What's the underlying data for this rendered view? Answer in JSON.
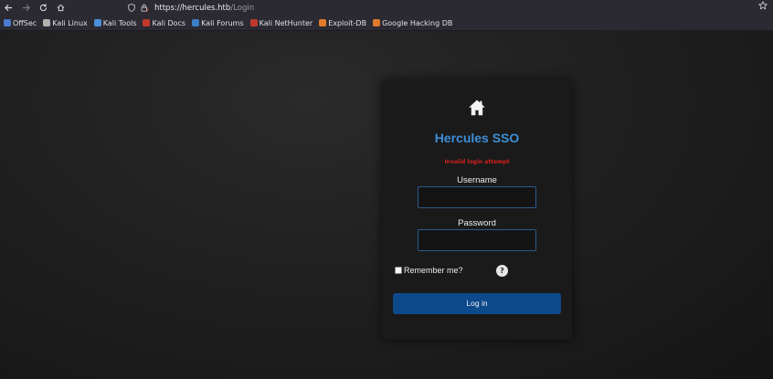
{
  "browser": {
    "nav": {
      "back_icon": "arrow-left-icon",
      "forward_icon": "arrow-right-icon",
      "reload_icon": "reload-icon",
      "home_icon": "home-icon"
    },
    "url_host": "https://hercules.htb",
    "url_path": "/Login",
    "bookmarks": [
      {
        "label": "OffSec",
        "color": "#4a7bd0"
      },
      {
        "label": "Kali Linux",
        "color": "#b0b0b0"
      },
      {
        "label": "Kali Tools",
        "color": "#4a90d9"
      },
      {
        "label": "Kali Docs",
        "color": "#c0392b"
      },
      {
        "label": "Kali Forums",
        "color": "#3b7fc4"
      },
      {
        "label": "Kali NetHunter",
        "color": "#c0392b"
      },
      {
        "label": "Exploit-DB",
        "color": "#e07a2a"
      },
      {
        "label": "Google Hacking DB",
        "color": "#e07a2a"
      }
    ]
  },
  "login": {
    "title": "Hercules SSO",
    "error": "Invalid login attempt",
    "username_label": "Username",
    "username_value": "",
    "password_label": "Password",
    "password_value": "",
    "remember_label": "Remember me?",
    "help_label": "?",
    "submit_label": "Log in",
    "colors": {
      "title": "#3d8fd8",
      "error": "#d42020",
      "button": "#0d4a8c"
    }
  }
}
